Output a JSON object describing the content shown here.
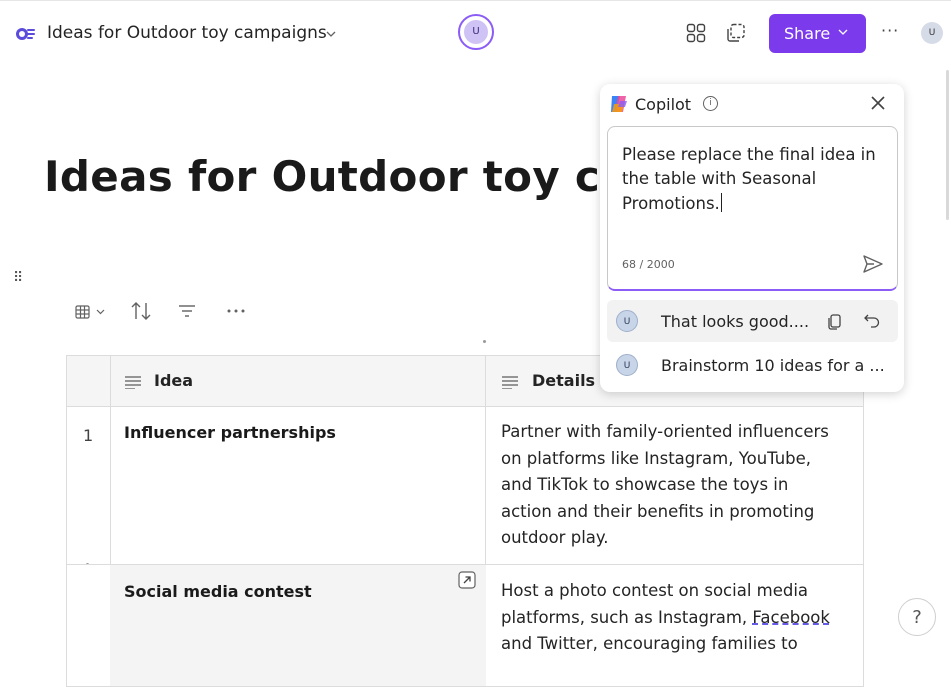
{
  "header": {
    "doc_title": "Ideas for Outdoor toy campaigns",
    "presence_initial": "U",
    "share_label": "Share",
    "avatar_initial": "U",
    "icons": [
      "loop-app-icon",
      "chevron-down-icon",
      "apps-grid-icon",
      "copy-page-icon",
      "more-icon"
    ]
  },
  "page": {
    "title": "Ideas for Outdoor toy campaigns"
  },
  "table": {
    "headers": [
      "Idea",
      "Details"
    ],
    "rows": [
      {
        "num": "1",
        "idea": "Influencer partnerships",
        "details": "Partner with family-oriented influencers on platforms like Instagram, YouTube, and TikTok to showcase the toys in action and their benefits in promoting outdoor play."
      },
      {
        "num": "",
        "idea": "Social media contest",
        "details_before": "Host a photo contest on social media platforms, such as Instagram, ",
        "details_flagged": "Facebook",
        "details_after": " and Twitter, encouraging families to"
      }
    ]
  },
  "copilot": {
    "title": "Copilot",
    "info_symbol": "i",
    "prompt_text": "Please replace the final idea in the table with Seasonal Promotions.",
    "char_count": "68 / 2000",
    "suggestions": [
      {
        "initial": "U",
        "text": "That looks good...."
      },
      {
        "initial": "U",
        "text": "Brainstorm 10 ideas for a ..."
      }
    ]
  },
  "help": {
    "label": "?"
  },
  "colors": {
    "accent": "#7c3aed",
    "focus_border": "#8b5cf6"
  }
}
